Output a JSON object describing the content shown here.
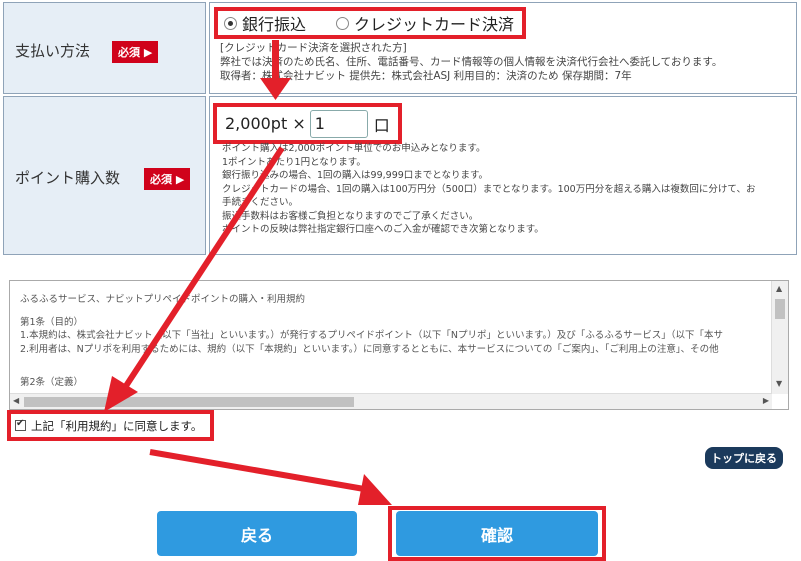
{
  "payment": {
    "label": "支払い方法",
    "required": "必須",
    "options": [
      {
        "label": "銀行振込",
        "selected": true
      },
      {
        "label": "クレジットカード決済",
        "selected": false
      }
    ],
    "notes": [
      "[クレジットカード決済を選択された方]",
      "弊社では決済のため氏名、住所、電話番号、カード情報等の個人情報を決済代行会社へ委託しております。",
      "取得者：株式会社ナビット 提供先：株式会社ASJ 利用目的：決済のため 保存期間：7年"
    ]
  },
  "points": {
    "label": "ポイント購入数",
    "required": "必須",
    "unit_price": "2,000pt ×",
    "quantity": "1",
    "unit": "口",
    "notes": [
      "ポイント購入は2,000ポイント単位でのお申込みとなります。",
      "1ポイントあたり1円となります。",
      "銀行振り込みの場合、1回の購入は99,999口までとなります。",
      "クレジットカードの場合、1回の購入は100万円分（500口）までとなります。100万円分を超える購入は複数回に分けて、お",
      "手続きください。",
      "振込手数料はお客様ご負担となりますのでご了承ください。",
      "ポイントの反映は弊社指定銀行口座へのご入金が確認でき次第となります。"
    ]
  },
  "terms": {
    "title": "ふるふるサービス、ナビットプリペイドポイントの購入・利用規約",
    "article1": "第1条（目的）",
    "line1": "1.本規約は、株式会社ナビット（以下「当社」といいます。）が発行するプリペイドポイント（以下「Nプリポ」といいます。）及び「ふるふるサービス」（以下「本サ",
    "line2": "2.利用者は、Nプリポを利用するためには、規約（以下「本規約」といいます。）に同意するとともに、本サービスについての「ご案内」、「ご利用上の注意」、その他",
    "article2": "第2条（定義）"
  },
  "agree": {
    "label": "上記「利用規約」に同意します。",
    "checked": true
  },
  "to_top": "トップに戻る",
  "buttons": {
    "back": "戻る",
    "confirm": "確認"
  },
  "colors": {
    "highlight": "#e3202a",
    "button": "#2f9ae0",
    "label_bg": "#e6eef6"
  }
}
